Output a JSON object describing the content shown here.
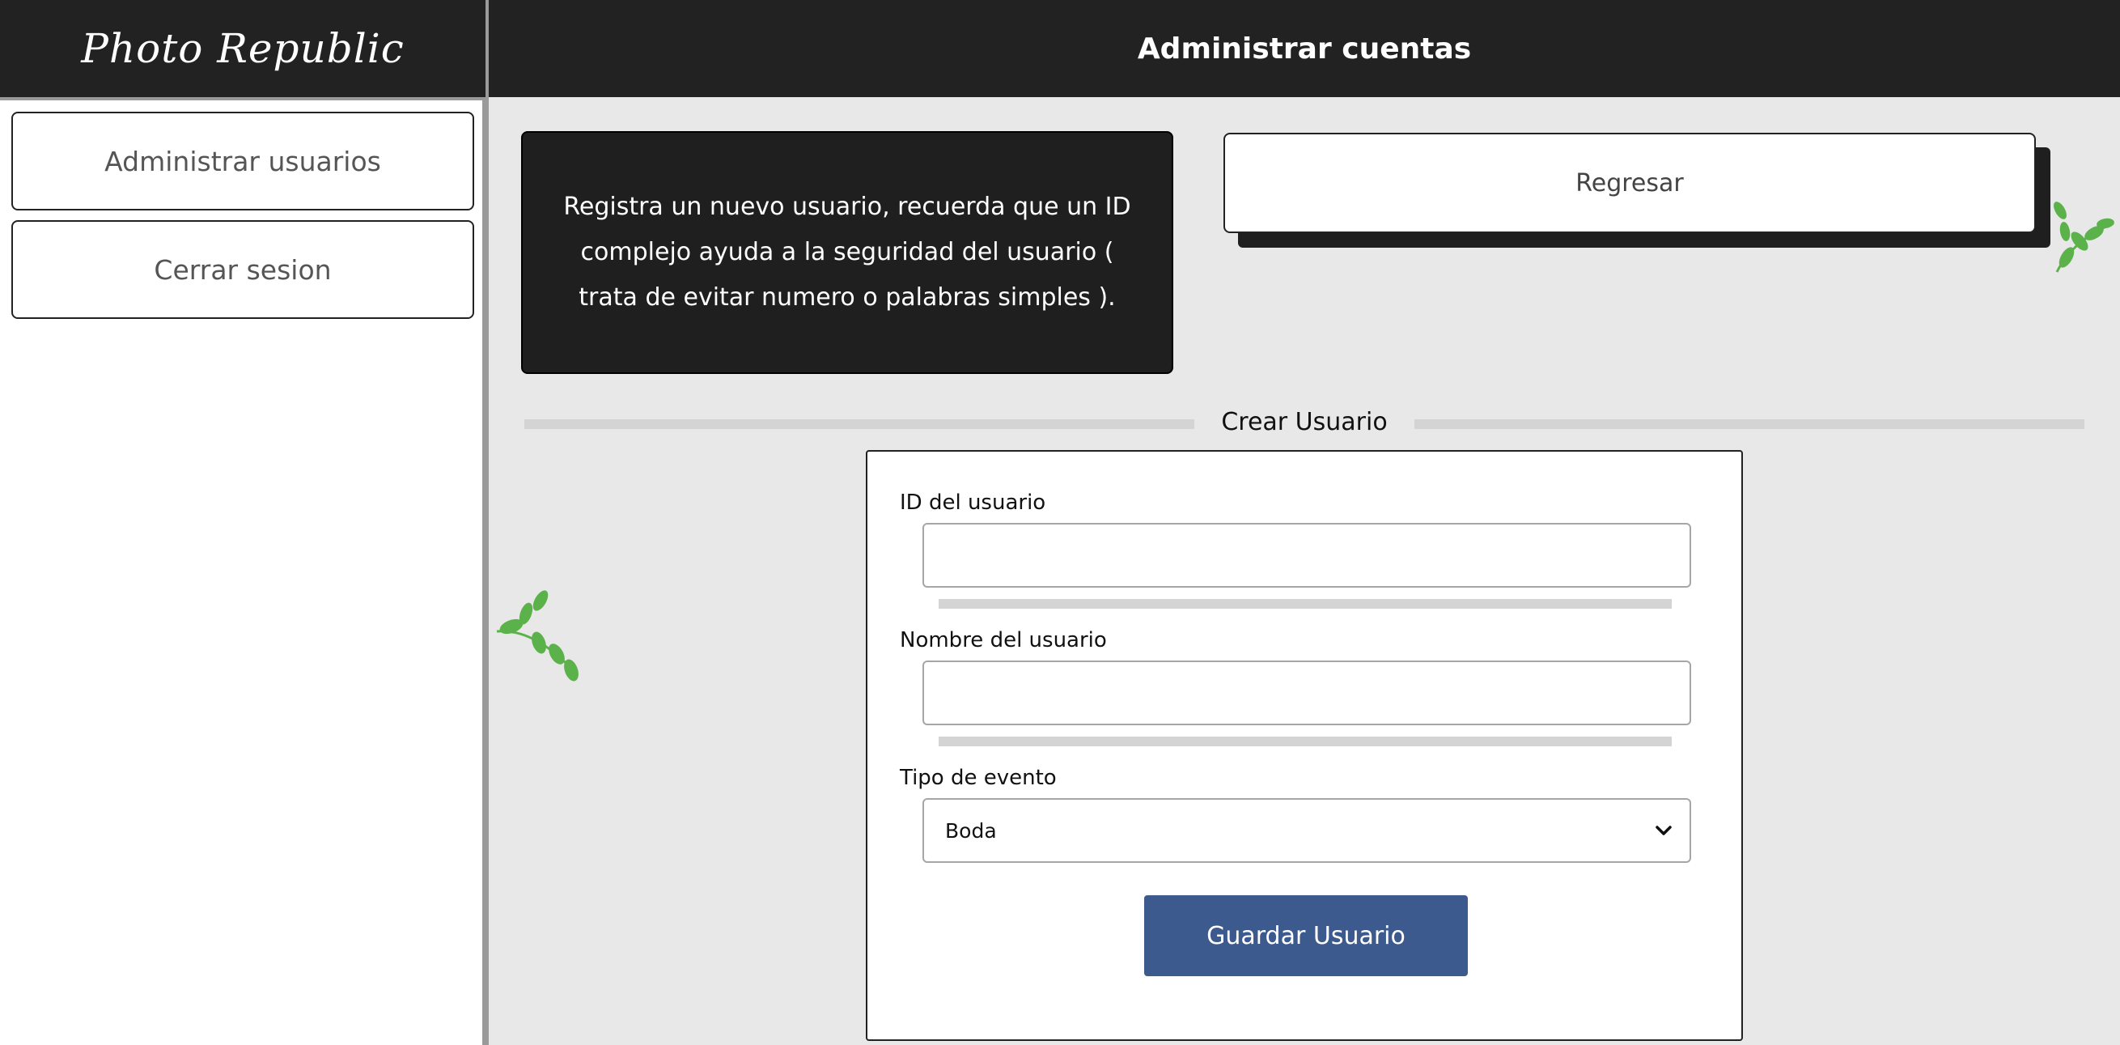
{
  "brand": "Photo Republic",
  "header": {
    "title": "Administrar cuentas"
  },
  "sidebar": {
    "items": [
      {
        "label": "Administrar usuarios"
      },
      {
        "label": "Cerrar sesion"
      }
    ]
  },
  "info": {
    "text": "Registra un nuevo usuario, recuerda que un ID complejo ayuda a la seguridad del usuario ( trata de evitar numero o palabras simples )."
  },
  "actions": {
    "back_label": "Regresar"
  },
  "form": {
    "section_title": "Crear Usuario",
    "user_id": {
      "label": "ID del usuario",
      "value": ""
    },
    "user_name": {
      "label": "Nombre del usuario",
      "value": ""
    },
    "event_type": {
      "label": "Tipo de evento",
      "selected": "Boda"
    },
    "save_label": "Guardar Usuario"
  },
  "colors": {
    "header_bg": "#222222",
    "content_bg": "#e8e8e8",
    "accent_button": "#3d5a8e",
    "leaf_green": "#5cb24a"
  },
  "icons": [
    "leaf-branch-icon",
    "chevron-down-icon"
  ]
}
